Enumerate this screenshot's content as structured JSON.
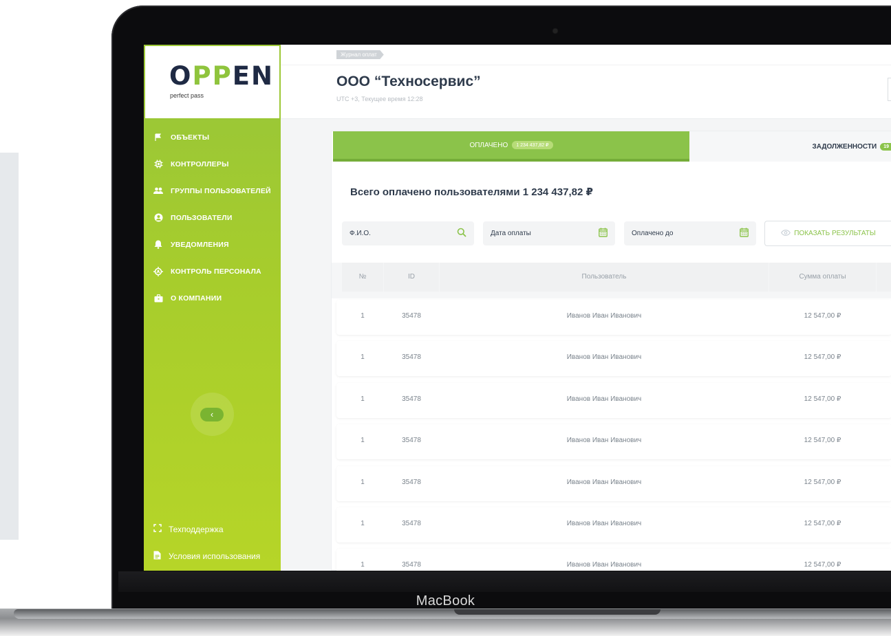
{
  "device": {
    "brand": "MacBook"
  },
  "logo": {
    "main_start": "O",
    "main_pp": "PP",
    "main_end": "EN",
    "tagline": "perfect pass"
  },
  "sidebar": {
    "items": [
      {
        "label": "ОБЪЕКТЫ",
        "icon": "flag-icon"
      },
      {
        "label": "КОНТРОЛЛЕРЫ",
        "icon": "chip-icon"
      },
      {
        "label": "ГРУППЫ ПОЛЬЗОВАТЕЛЕЙ",
        "icon": "users-icon"
      },
      {
        "label": "ПОЛЬЗОВАТЕЛИ",
        "icon": "user-circle-icon"
      },
      {
        "label": "УВЕДОМЛЕНИЯ",
        "icon": "bell-icon"
      },
      {
        "label": "КОНТРОЛЬ ПЕРСОНАЛА",
        "icon": "staff-control-icon"
      },
      {
        "label": "О КОМПАНИИ",
        "icon": "briefcase-icon"
      }
    ],
    "collapse_symbol": "‹",
    "footer": [
      {
        "label": "Техподдержка",
        "icon": "support-icon"
      },
      {
        "label": "Условия использования",
        "icon": "document-icon"
      }
    ],
    "accent_color": "#a7cd2c"
  },
  "header": {
    "breadcrumb": "Журнал оплат",
    "title": "ООО “Техносервис”",
    "subtitle": "UTC +3, Текущее время 12:28"
  },
  "tabs": {
    "paid": {
      "label": "ОПЛАЧЕНО",
      "badge": "1 234 437,82 ₽"
    },
    "debts": {
      "label": "ЗАДОЛЖЕННОСТИ",
      "badge": "19"
    }
  },
  "summary": {
    "total_text": "Всего оплачено пользователями 1 234 437,82 ₽"
  },
  "filters": {
    "name_placeholder": "Ф.И.О.",
    "date_placeholder": "Дата оплаты",
    "paid_until_placeholder": "Оплачено до",
    "show_button": "ПОКАЗАТЬ РЕЗУЛЬТАТЫ"
  },
  "table": {
    "columns": [
      "№",
      "ID",
      "Пользователь",
      "Сумма оплаты"
    ],
    "rows": [
      [
        "1",
        "35478",
        "Иванов Иван Иванович",
        "12 547,00 ₽"
      ],
      [
        "1",
        "35478",
        "Иванов Иван Иванович",
        "12 547,00 ₽"
      ],
      [
        "1",
        "35478",
        "Иванов Иван Иванович",
        "12 547,00 ₽"
      ],
      [
        "1",
        "35478",
        "Иванов Иван Иванович",
        "12 547,00 ₽"
      ],
      [
        "1",
        "35478",
        "Иванов Иван Иванович",
        "12 547,00 ₽"
      ],
      [
        "1",
        "35478",
        "Иванов Иван Иванович",
        "12 547,00 ₽"
      ],
      [
        "1",
        "35478",
        "Иванов Иван Иванович",
        "12 547,00 ₽"
      ]
    ]
  },
  "colors": {
    "primary_green": "#8bc34a",
    "title_dark": "#2f3b4c"
  }
}
